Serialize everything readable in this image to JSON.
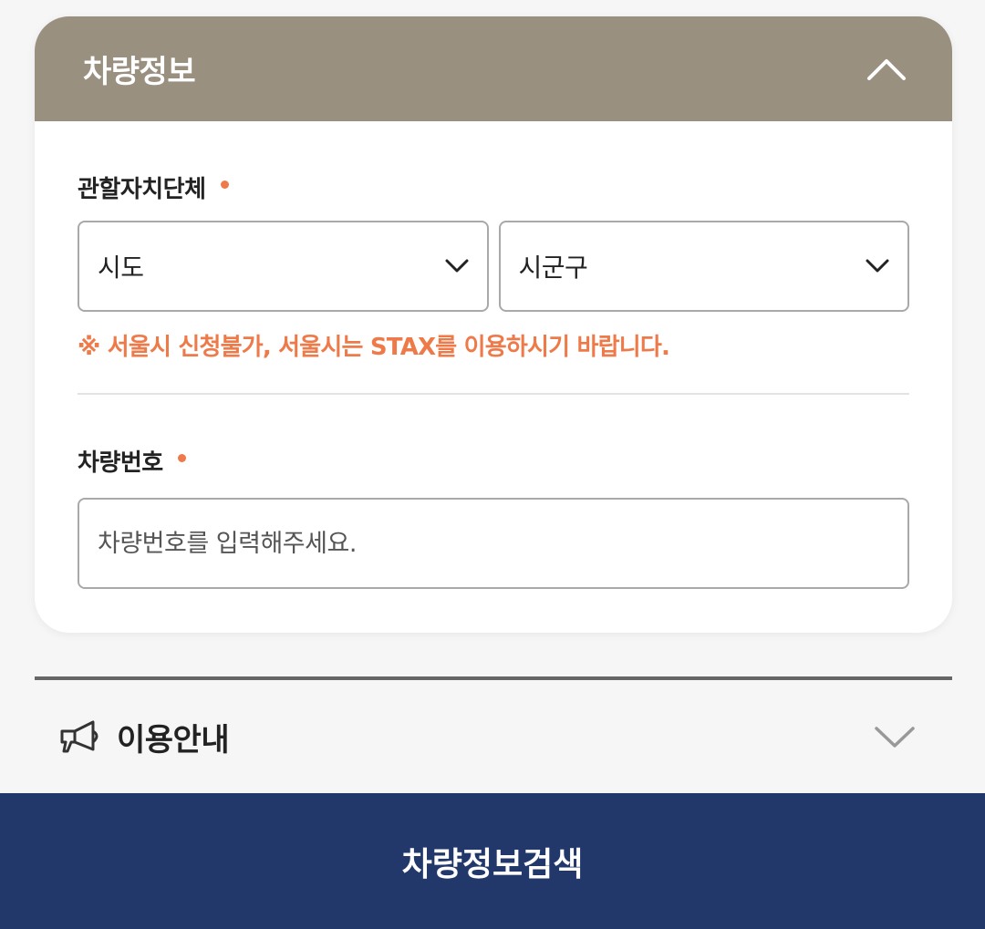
{
  "card": {
    "title": "차량정보",
    "collapse_icon": "chevron-up-icon"
  },
  "region": {
    "label": "관할자치단체",
    "sido_value": "시도",
    "sigungu_value": "시군구",
    "warning": "※ 서울시 신청불가, 서울시는 STAX를 이용하시기 바랍니다."
  },
  "vehicle": {
    "label": "차량번호",
    "placeholder": "차량번호를 입력해주세요."
  },
  "info": {
    "title": "이용안내",
    "icon": "megaphone-icon",
    "expand_icon": "chevron-down-icon"
  },
  "search_button": {
    "label": "차량정보검색"
  },
  "colors": {
    "header_bg": "#9a9080",
    "accent_orange": "#ee7a4a",
    "button_navy": "#22386b"
  }
}
